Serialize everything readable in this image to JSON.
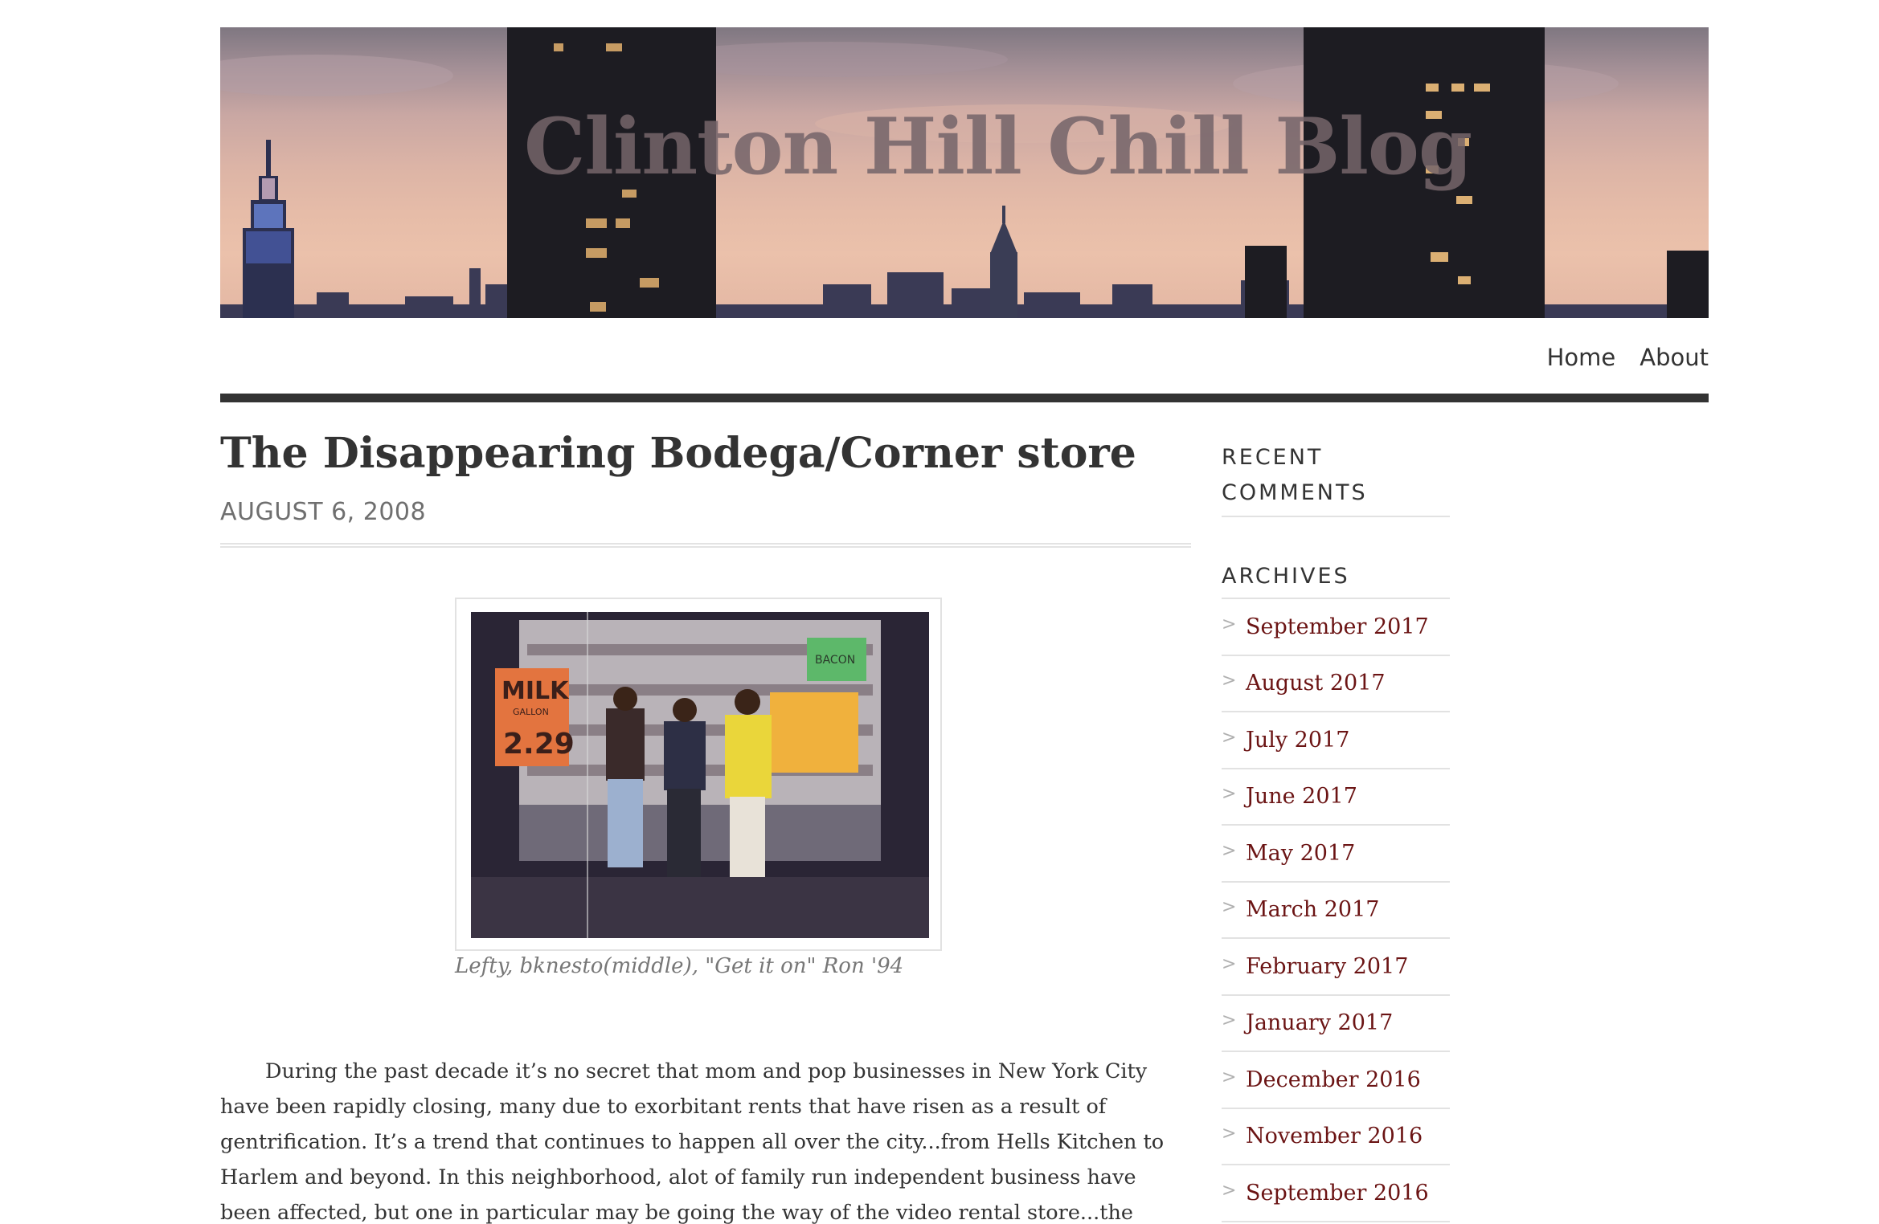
{
  "header": {
    "site_title": "Clinton Hill Chill Blog"
  },
  "nav": {
    "items": [
      "Home",
      "About"
    ]
  },
  "post": {
    "title": "The Disappearing Bodega/Corner store",
    "date": "AUGUST 6, 2008",
    "image": {
      "sign_milk": "MILK",
      "sign_gallon": "GALLON",
      "sign_price": "2.29",
      "sign_bacon": "BACON"
    },
    "caption": "Lefty, bknesto(middle), \"Get it on\" Ron '94",
    "body": "During the past decade it’s no secret that mom and pop businesses in New York City have been rapidly closing, many due to exorbitant rents that have risen as a result of gentrification. It’s a trend that continues to happen all over the city...from Hells Kitchen to Harlem and beyond.  In this neighborhood, alot of family run independent business have been affected, but one in particular may be going the way of the video rental store...the bodega/corner store/convenience store."
  },
  "sidebar": {
    "recent_comments_title": "RECENT COMMENTS",
    "archives_title": "ARCHIVES",
    "archives": [
      "September 2017",
      "August 2017",
      "July 2017",
      "June 2017",
      "May 2017",
      "March 2017",
      "February 2017",
      "January 2017",
      "December 2016",
      "November 2016",
      "September 2016"
    ],
    "link_color": "#6b1414"
  }
}
